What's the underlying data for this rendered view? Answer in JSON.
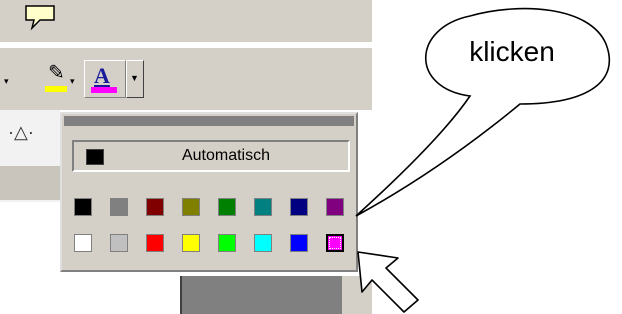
{
  "toolbar": {
    "highlight_color": "#ffff00",
    "font_color": "#ff00ff",
    "font_color_letter": "A",
    "highlighter_icon": "highlighter-pen-icon",
    "dropdown_glyph": "▼",
    "arrow_glyph": "▾"
  },
  "color_picker": {
    "automatic_label": "Automatisch",
    "automatic_color": "#000000",
    "row1": [
      "#000000",
      "#808080",
      "#800000",
      "#808000",
      "#008000",
      "#008080",
      "#000080",
      "#800080"
    ],
    "row2": [
      "#ffffff",
      "#c0c0c0",
      "#ff0000",
      "#ffff00",
      "#00ff00",
      "#00ffff",
      "#0000ff",
      "#ff00ff"
    ],
    "selected_color": "#ff00ff"
  },
  "callout": {
    "text": "klicken"
  }
}
